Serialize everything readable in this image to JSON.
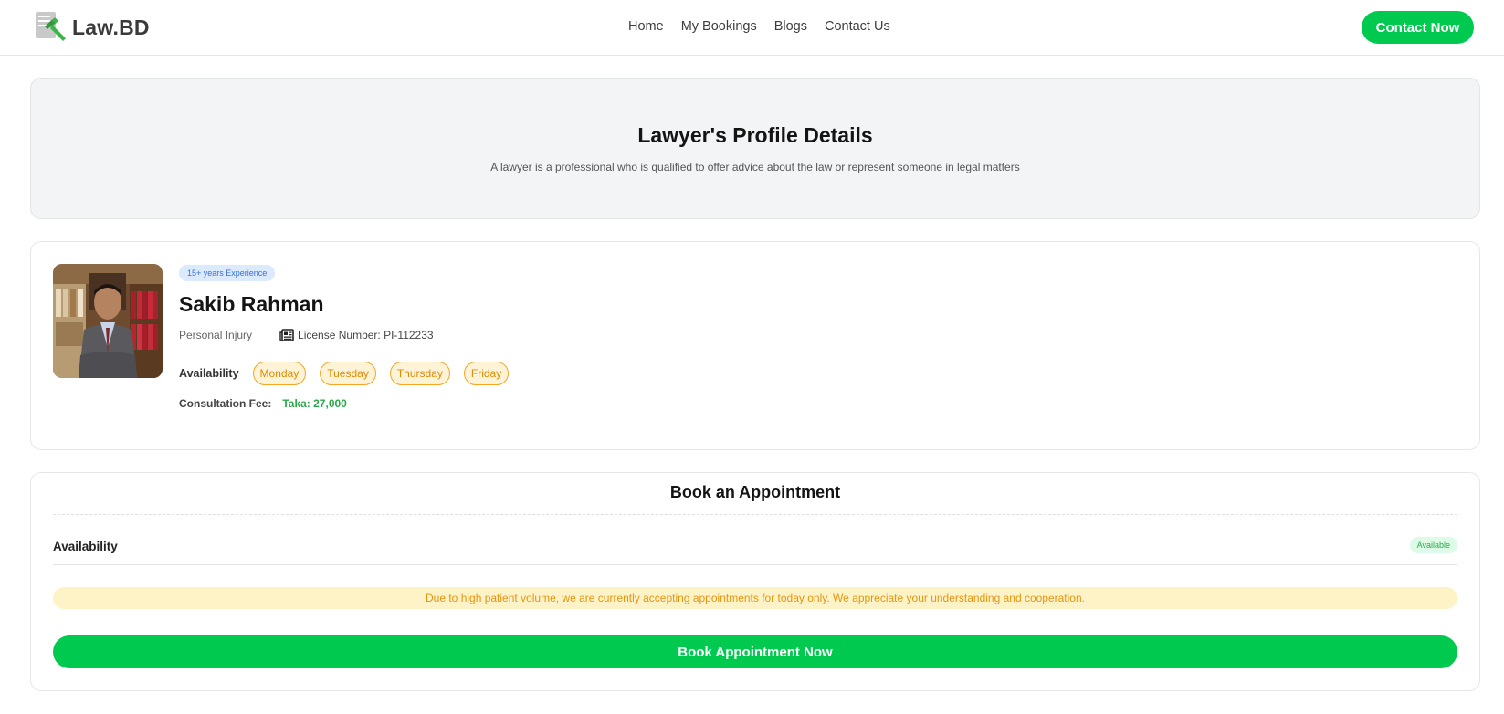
{
  "brand": {
    "name": "Law.BD",
    "logo_icon": "gavel-document-icon"
  },
  "nav": {
    "links": [
      "Home",
      "My Bookings",
      "Blogs",
      "Contact Us"
    ],
    "contact_button": "Contact Now"
  },
  "hero": {
    "title": "Lawyer's Profile Details",
    "subtitle": "A lawyer is a professional who is qualified to offer advice about the law or represent someone in legal matters"
  },
  "profile": {
    "experience_badge": "15+ years Experience",
    "name": "Sakib Rahman",
    "specialty": "Personal Injury",
    "license_icon": "newspaper-icon",
    "license": "License Number: PI-112233",
    "availability_label": "Availability",
    "days": [
      "Monday",
      "Tuesday",
      "Thursday",
      "Friday"
    ],
    "fee_label": "Consultation Fee:",
    "fee_value": "Taka: 27,000"
  },
  "booking": {
    "title": "Book an Appointment",
    "availability_label": "Availability",
    "status_badge": "Available",
    "notice": "Due to high patient volume, we are currently accepting appointments for today only. We appreciate your understanding and cooperation.",
    "button": "Book Appointment Now"
  },
  "colors": {
    "primary_green": "#00c950",
    "fee_green": "#2ba84a",
    "day_pill_orange": "#f5a623",
    "notice_bg": "#fef3c7",
    "badge_blue_bg": "#dbeafe"
  }
}
